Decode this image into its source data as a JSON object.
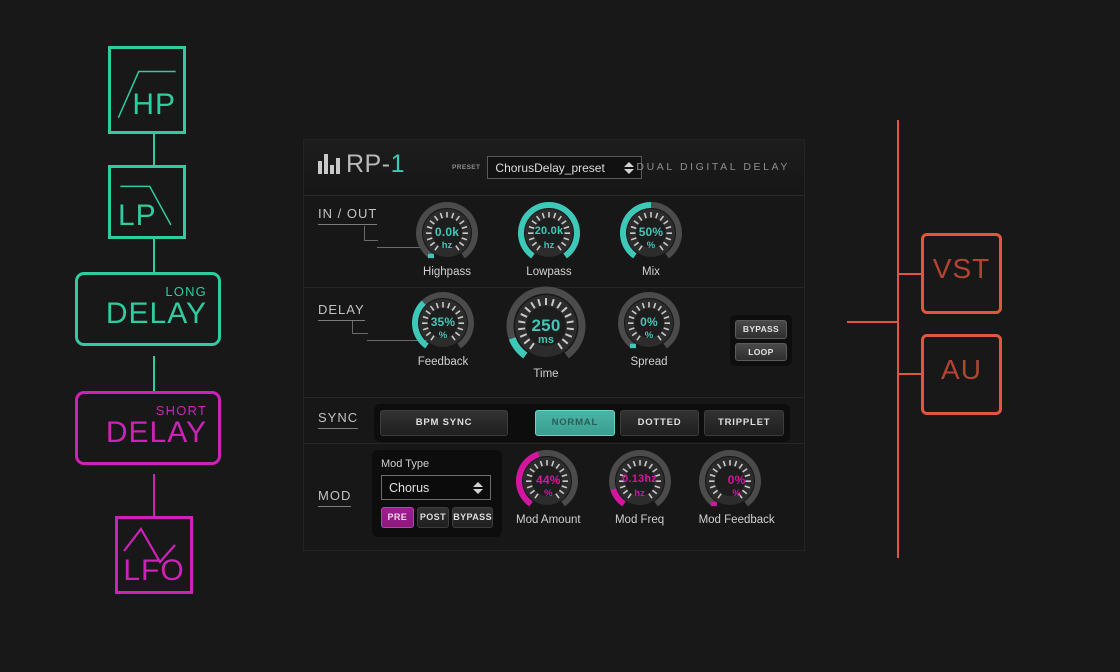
{
  "canvas": {
    "bg": "#181818"
  },
  "colors": {
    "teal": "#3ec8b8",
    "teal_flow": "#2ecc9e",
    "magenta": "#cc22b8",
    "magenta_knob": "#d4159f",
    "salmon": "#e2553f",
    "panel_bg": "#171717"
  },
  "flow": {
    "nodes": [
      {
        "id": "hp",
        "label": "HP",
        "sub": "",
        "color": "#2ecc9e",
        "graphic": "highpass-curve"
      },
      {
        "id": "lp",
        "label": "LP",
        "sub": "",
        "color": "#2ecc9e",
        "graphic": "lowpass-curve"
      },
      {
        "id": "long",
        "label": "DELAY",
        "sub": "LONG",
        "color": "#2ecc9e",
        "graphic": "none"
      },
      {
        "id": "short",
        "label": "DELAY",
        "sub": "SHORT",
        "color": "#cc22b8",
        "graphic": "none"
      },
      {
        "id": "lfo",
        "label": "LFO",
        "sub": "",
        "color": "#cc22b8",
        "graphic": "triangle-wave"
      }
    ]
  },
  "formats": {
    "nodes": [
      {
        "id": "vst",
        "label": "VST",
        "color": "#e2553f"
      },
      {
        "id": "au",
        "label": "AU",
        "color": "#e2553f"
      }
    ]
  },
  "plugin": {
    "header": {
      "logo_text_main": "RP-",
      "logo_text_accent": "1",
      "preset_label": "PRESET",
      "preset_value": "ChorusDelay_preset",
      "subtitle": "DUAL DIGITAL DELAY"
    },
    "sections": [
      {
        "id": "inout",
        "title": "IN / OUT",
        "knobs": [
          {
            "name": "Highpass",
            "value": "0.0k",
            "unit": "hz",
            "pct": 0,
            "color": "#3ec8b8",
            "size": "med"
          },
          {
            "name": "Lowpass",
            "value": "20.0k",
            "unit": "hz",
            "pct": 100,
            "color": "#3ec8b8",
            "size": "med"
          },
          {
            "name": "Mix",
            "value": "50%",
            "unit": "%",
            "pct": 50,
            "color": "#3ec8b8",
            "size": "med"
          }
        ]
      },
      {
        "id": "delay",
        "title": "DELAY",
        "knobs": [
          {
            "name": "Feedback",
            "value": "35%",
            "unit": "%",
            "pct": 35,
            "color": "#3ec8b8",
            "size": "med"
          },
          {
            "name": "Time",
            "value": "250",
            "unit": "ms",
            "pct": 12,
            "color": "#3ec8b8",
            "size": "big"
          },
          {
            "name": "Spread",
            "value": "0%",
            "unit": "%",
            "pct": 0,
            "color": "#3ec8b8",
            "size": "med"
          }
        ],
        "buttons": [
          {
            "label": "BYPASS",
            "active": false
          },
          {
            "label": "LOOP",
            "active": false
          }
        ]
      },
      {
        "id": "sync",
        "title": "SYNC",
        "buttons": [
          {
            "label": "BPM SYNC",
            "active": false
          },
          {
            "label": "NORMAL",
            "active": true
          },
          {
            "label": "DOTTED",
            "active": false
          },
          {
            "label": "TRIPPLET",
            "active": false
          }
        ]
      },
      {
        "id": "mod",
        "title": "MOD",
        "mod_type_label": "Mod Type",
        "mod_type_value": "Chorus",
        "placement_buttons": [
          {
            "label": "PRE",
            "active": true
          },
          {
            "label": "POST",
            "active": false
          },
          {
            "label": "BYPASS",
            "active": false
          }
        ],
        "knobs": [
          {
            "name": "Mod Amount",
            "value": "44%",
            "unit": "%",
            "pct": 44,
            "color": "#d4159f",
            "size": "med"
          },
          {
            "name": "Mod Freq",
            "value": "0.13hz",
            "unit": "hz",
            "pct": 13,
            "color": "#d4159f",
            "size": "med"
          },
          {
            "name": "Mod Feedback",
            "value": "0%",
            "unit": "%",
            "pct": 0,
            "color": "#d4159f",
            "size": "med"
          }
        ]
      }
    ]
  }
}
